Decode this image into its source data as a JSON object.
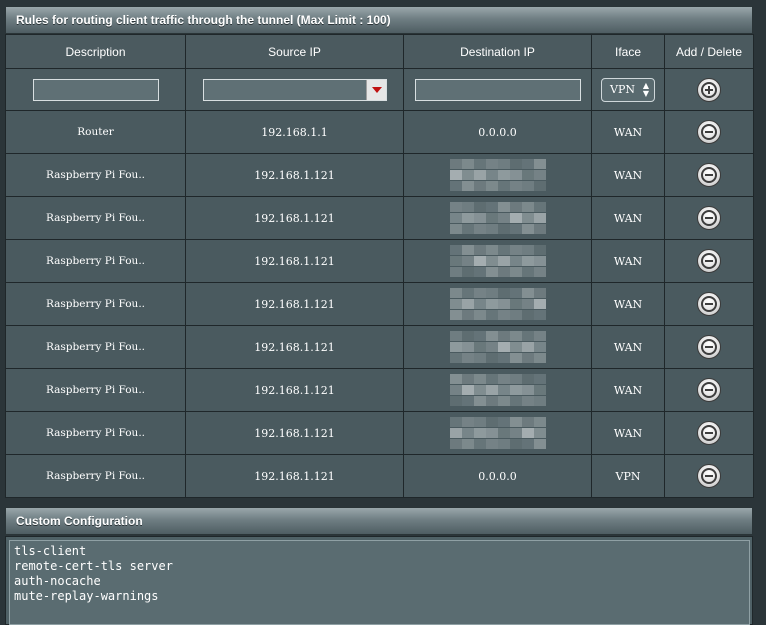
{
  "rules_section": {
    "title": "Rules for routing client traffic through the tunnel (Max Limit : 100)",
    "columns": [
      "Description",
      "Source IP",
      "Destination IP",
      "Iface",
      "Add / Delete"
    ],
    "input_row": {
      "description_value": "",
      "source_ip_value": "",
      "destination_ip_value": "",
      "iface_value": "VPN",
      "add_icon": "plus-circle-icon"
    },
    "rows": [
      {
        "description": "Router",
        "source_ip": "192.168.1.1",
        "destination_ip": "0.0.0.0",
        "destination_blurred": false,
        "iface": "WAN"
      },
      {
        "description": "Raspberry Pi Fou..",
        "source_ip": "192.168.1.121",
        "destination_ip": "",
        "destination_blurred": true,
        "iface": "WAN"
      },
      {
        "description": "Raspberry Pi Fou..",
        "source_ip": "192.168.1.121",
        "destination_ip": "",
        "destination_blurred": true,
        "iface": "WAN"
      },
      {
        "description": "Raspberry Pi Fou..",
        "source_ip": "192.168.1.121",
        "destination_ip": "",
        "destination_blurred": true,
        "iface": "WAN"
      },
      {
        "description": "Raspberry Pi Fou..",
        "source_ip": "192.168.1.121",
        "destination_ip": "",
        "destination_blurred": true,
        "iface": "WAN"
      },
      {
        "description": "Raspberry Pi Fou..",
        "source_ip": "192.168.1.121",
        "destination_ip": "",
        "destination_blurred": true,
        "iface": "WAN"
      },
      {
        "description": "Raspberry Pi Fou..",
        "source_ip": "192.168.1.121",
        "destination_ip": "",
        "destination_blurred": true,
        "iface": "WAN"
      },
      {
        "description": "Raspberry Pi Fou..",
        "source_ip": "192.168.1.121",
        "destination_ip": "",
        "destination_blurred": true,
        "iface": "WAN"
      },
      {
        "description": "Raspberry Pi Fou..",
        "source_ip": "192.168.1.121",
        "destination_ip": "0.0.0.0",
        "destination_blurred": false,
        "iface": "VPN"
      }
    ],
    "delete_icon": "minus-circle-icon"
  },
  "custom_section": {
    "title": "Custom Configuration",
    "config_text": "tls-client\nremote-cert-tls server\nauth-nocache\nmute-replay-warnings"
  },
  "colors": {
    "background": "#2b3539",
    "cell": "#4a5a5f",
    "dropdown_arrow": "#c01010"
  }
}
